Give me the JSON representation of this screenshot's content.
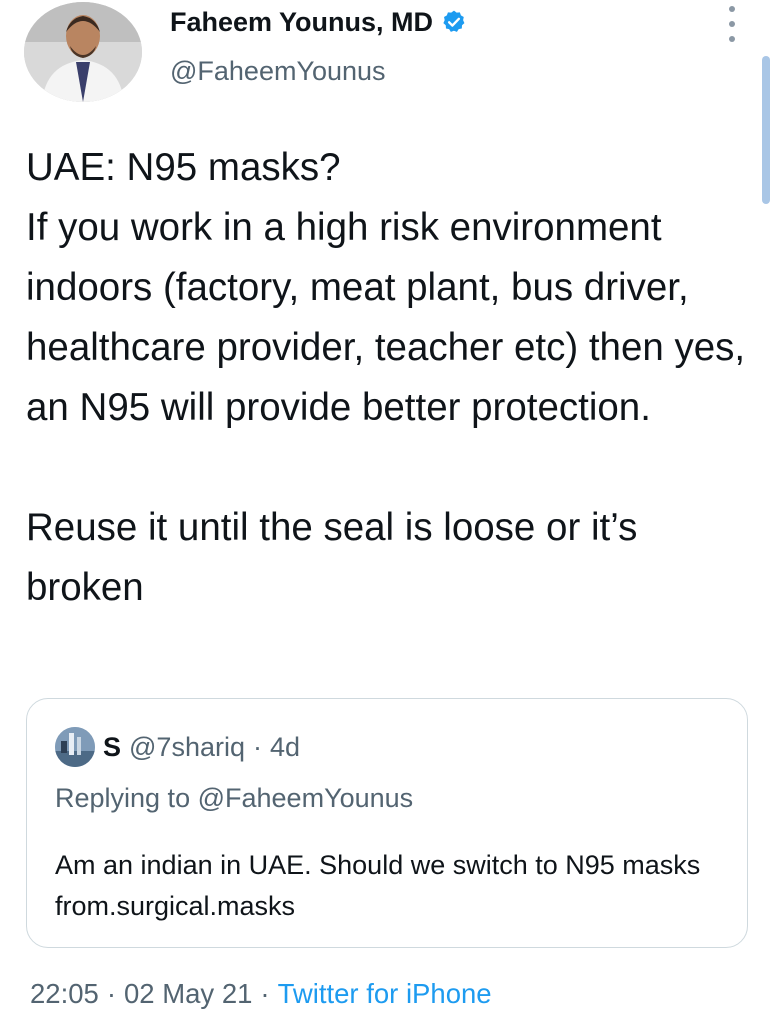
{
  "author": {
    "display_name": "Faheem Younus, MD",
    "handle": "@FaheemYounus",
    "verified_icon": "verified-badge-icon",
    "avatar_icon": "profile-photo"
  },
  "tweet": {
    "line1": "UAE: N95 masks?",
    "line2": "If you work in a high risk environment indoors (factory, meat plant, bus driver, healthcare provider, teacher etc) then yes, an N95 will provide better protection.",
    "line3": "Reuse it until the seal is loose or it’s broken"
  },
  "quoted": {
    "name": "S",
    "handle": "@7shariq",
    "separator": "·",
    "time": "4d",
    "replying_label": "Replying to",
    "replying_to": "@FaheemYounus",
    "body": "Am an indian in UAE. Should we switch to N95 masks from.surgical.masks"
  },
  "meta": {
    "time": "22:05",
    "sep1": "·",
    "date": "02 May 21",
    "sep2": "·",
    "source": "Twitter for iPhone"
  },
  "colors": {
    "text": "#0f1419",
    "secondary": "#536471",
    "link": "#1d9bf0",
    "border": "#cfd9de"
  }
}
